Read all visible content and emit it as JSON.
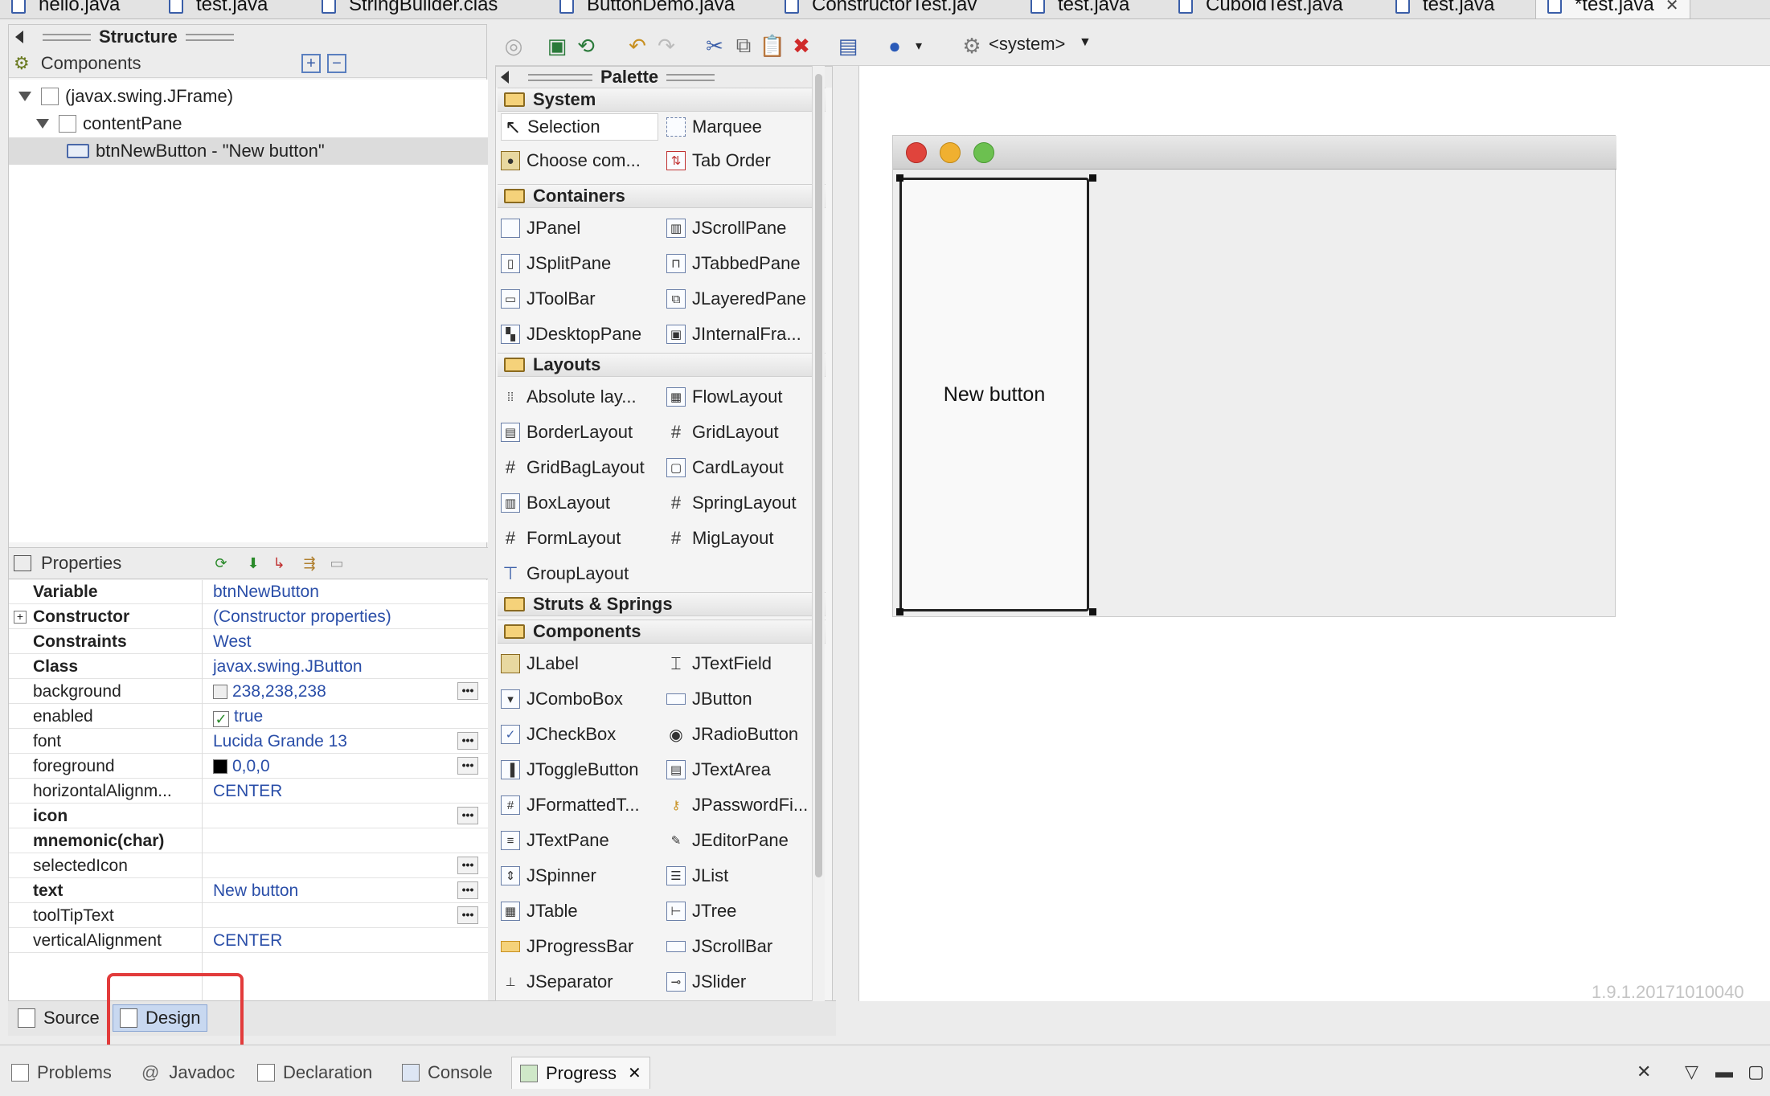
{
  "editor_tabs": [
    {
      "label": "hello.java"
    },
    {
      "label": "test.java"
    },
    {
      "label": "StringBuilder.clas"
    },
    {
      "label": "ButtonDemo.java"
    },
    {
      "label": "ConstructorTest.jav"
    },
    {
      "label": "test.java"
    },
    {
      "label": "CuboidTest.java"
    },
    {
      "label": "test.java"
    },
    {
      "label": "*test.java"
    }
  ],
  "structure": {
    "title": "Structure",
    "components_label": "Components",
    "tree": [
      {
        "label": "(javax.swing.JFrame)"
      },
      {
        "label": "contentPane"
      },
      {
        "label": "btnNewButton - \"New button\""
      }
    ]
  },
  "properties": {
    "title": "Properties",
    "rows": [
      {
        "name": "Variable",
        "value": "btnNewButton"
      },
      {
        "name": "Constructor",
        "value": "(Constructor properties)"
      },
      {
        "name": "Constraints",
        "value": "West"
      },
      {
        "name": "Class",
        "value": "javax.swing.JButton"
      },
      {
        "name": "background",
        "value": "238,238,238"
      },
      {
        "name": "enabled",
        "value": "true"
      },
      {
        "name": "font",
        "value": "Lucida Grande 13"
      },
      {
        "name": "foreground",
        "value": "0,0,0"
      },
      {
        "name": "horizontalAlignm...",
        "value": "CENTER"
      },
      {
        "name": "icon",
        "value": ""
      },
      {
        "name": "mnemonic(char)",
        "value": ""
      },
      {
        "name": "selectedIcon",
        "value": ""
      },
      {
        "name": "text",
        "value": "New button"
      },
      {
        "name": "toolTipText",
        "value": ""
      },
      {
        "name": "verticalAlignment",
        "value": "CENTER"
      }
    ]
  },
  "toolbar": {
    "system_label": "<system>"
  },
  "palette": {
    "title": "Palette",
    "categories": [
      {
        "name": "System",
        "items": [
          "Selection",
          "Marquee",
          "Choose com...",
          "Tab Order"
        ]
      },
      {
        "name": "Containers",
        "items": [
          "JPanel",
          "JScrollPane",
          "JSplitPane",
          "JTabbedPane",
          "JToolBar",
          "JLayeredPane",
          "JDesktopPane",
          "JInternalFra..."
        ]
      },
      {
        "name": "Layouts",
        "items": [
          "Absolute lay...",
          "FlowLayout",
          "BorderLayout",
          "GridLayout",
          "GridBagLayout",
          "CardLayout",
          "BoxLayout",
          "SpringLayout",
          "FormLayout",
          "MigLayout",
          "GroupLayout"
        ]
      },
      {
        "name": "Struts & Springs",
        "items": []
      },
      {
        "name": "Components",
        "items": [
          "JLabel",
          "JTextField",
          "JComboBox",
          "JButton",
          "JCheckBox",
          "JRadioButton",
          "JToggleButton",
          "JTextArea",
          "JFormattedT...",
          "JPasswordFi...",
          "JTextPane",
          "JEditorPane",
          "JSpinner",
          "JList",
          "JTable",
          "JTree",
          "JProgressBar",
          "JScrollBar",
          "JSeparator",
          "JSlider"
        ]
      }
    ]
  },
  "design": {
    "button_label": "New button",
    "version": "1.9.1.20171010040"
  },
  "editor_mode_tabs": {
    "source": "Source",
    "design": "Design"
  },
  "bottom_tabs": [
    {
      "label": "Problems"
    },
    {
      "label": "Javadoc"
    },
    {
      "label": "Declaration"
    },
    {
      "label": "Console"
    },
    {
      "label": "Progress"
    }
  ],
  "colors": {
    "highlight": "#e23b3b",
    "link": "#2a4ea8",
    "selection": "#c8d8f0"
  }
}
